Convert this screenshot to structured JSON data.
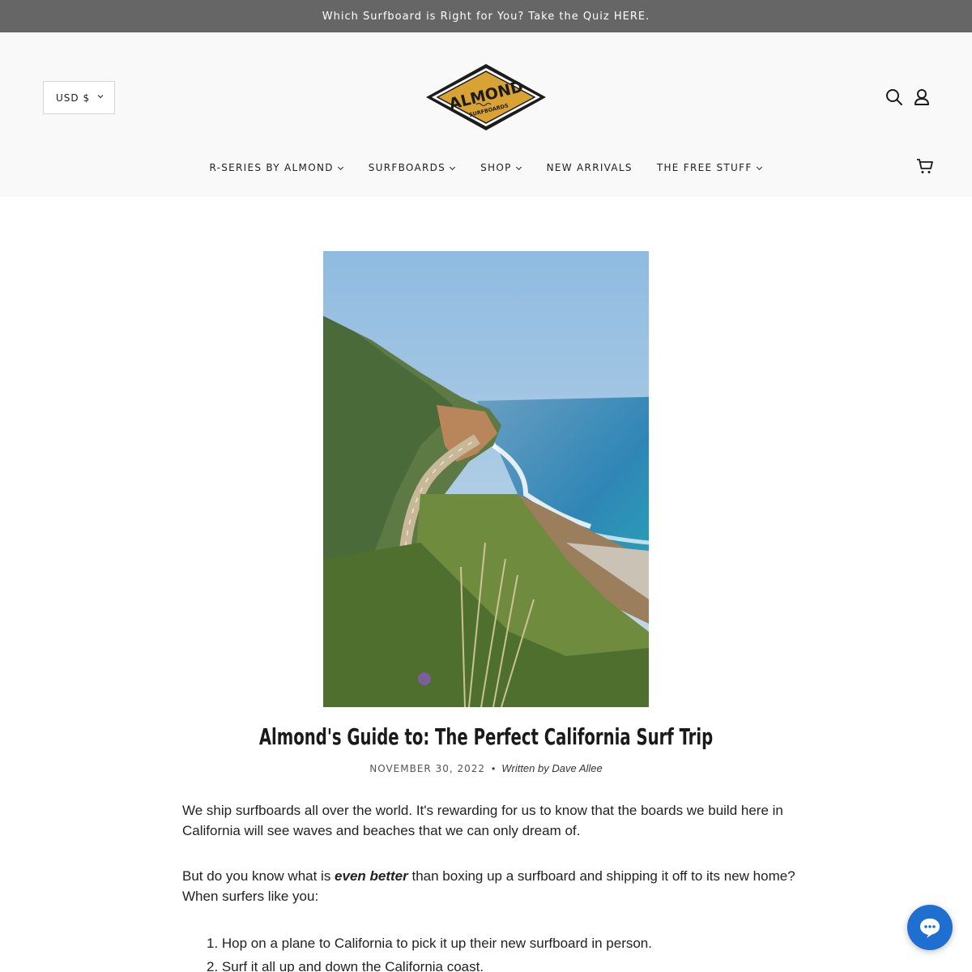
{
  "announcement": "Which Surfboard is Right for You? Take the Quiz HERE.",
  "currency": {
    "label": "USD $"
  },
  "logo": {
    "name": "ALMOND",
    "subtitle": "SURFBOARDS",
    "color": "#d9a334"
  },
  "nav": [
    {
      "label": "R-SERIES BY ALMOND",
      "has_dropdown": true
    },
    {
      "label": "SURFBOARDS",
      "has_dropdown": true
    },
    {
      "label": "SHOP",
      "has_dropdown": true
    },
    {
      "label": "NEW ARRIVALS",
      "has_dropdown": false
    },
    {
      "label": "THE FREE STUFF",
      "has_dropdown": true
    }
  ],
  "header_icons": [
    "search-icon",
    "account-icon",
    "cart-icon"
  ],
  "article": {
    "title": "Almond's Guide to: The Perfect California Surf Trip",
    "date": "NOVEMBER 30, 2022",
    "separator": "•",
    "author": "Written by Dave Allee",
    "paragraph1": "We ship surfboards all over the world. It's rewarding for us to know that the boards we build here in California will see waves and beaches that we can only dream of.",
    "paragraph2_before": "But do you know what is ",
    "paragraph2_emphasis": "even better",
    "paragraph2_after": " than boxing up a surfboard and shipping it off to its new home? When surfers like you:",
    "list": [
      "1. Hop on a plane to California to pick it up their new surfboard in person.",
      "2. Surf it all up and down the California coast."
    ]
  },
  "chat": {
    "icon": "chat-icon",
    "color": "#1f6fd1"
  }
}
